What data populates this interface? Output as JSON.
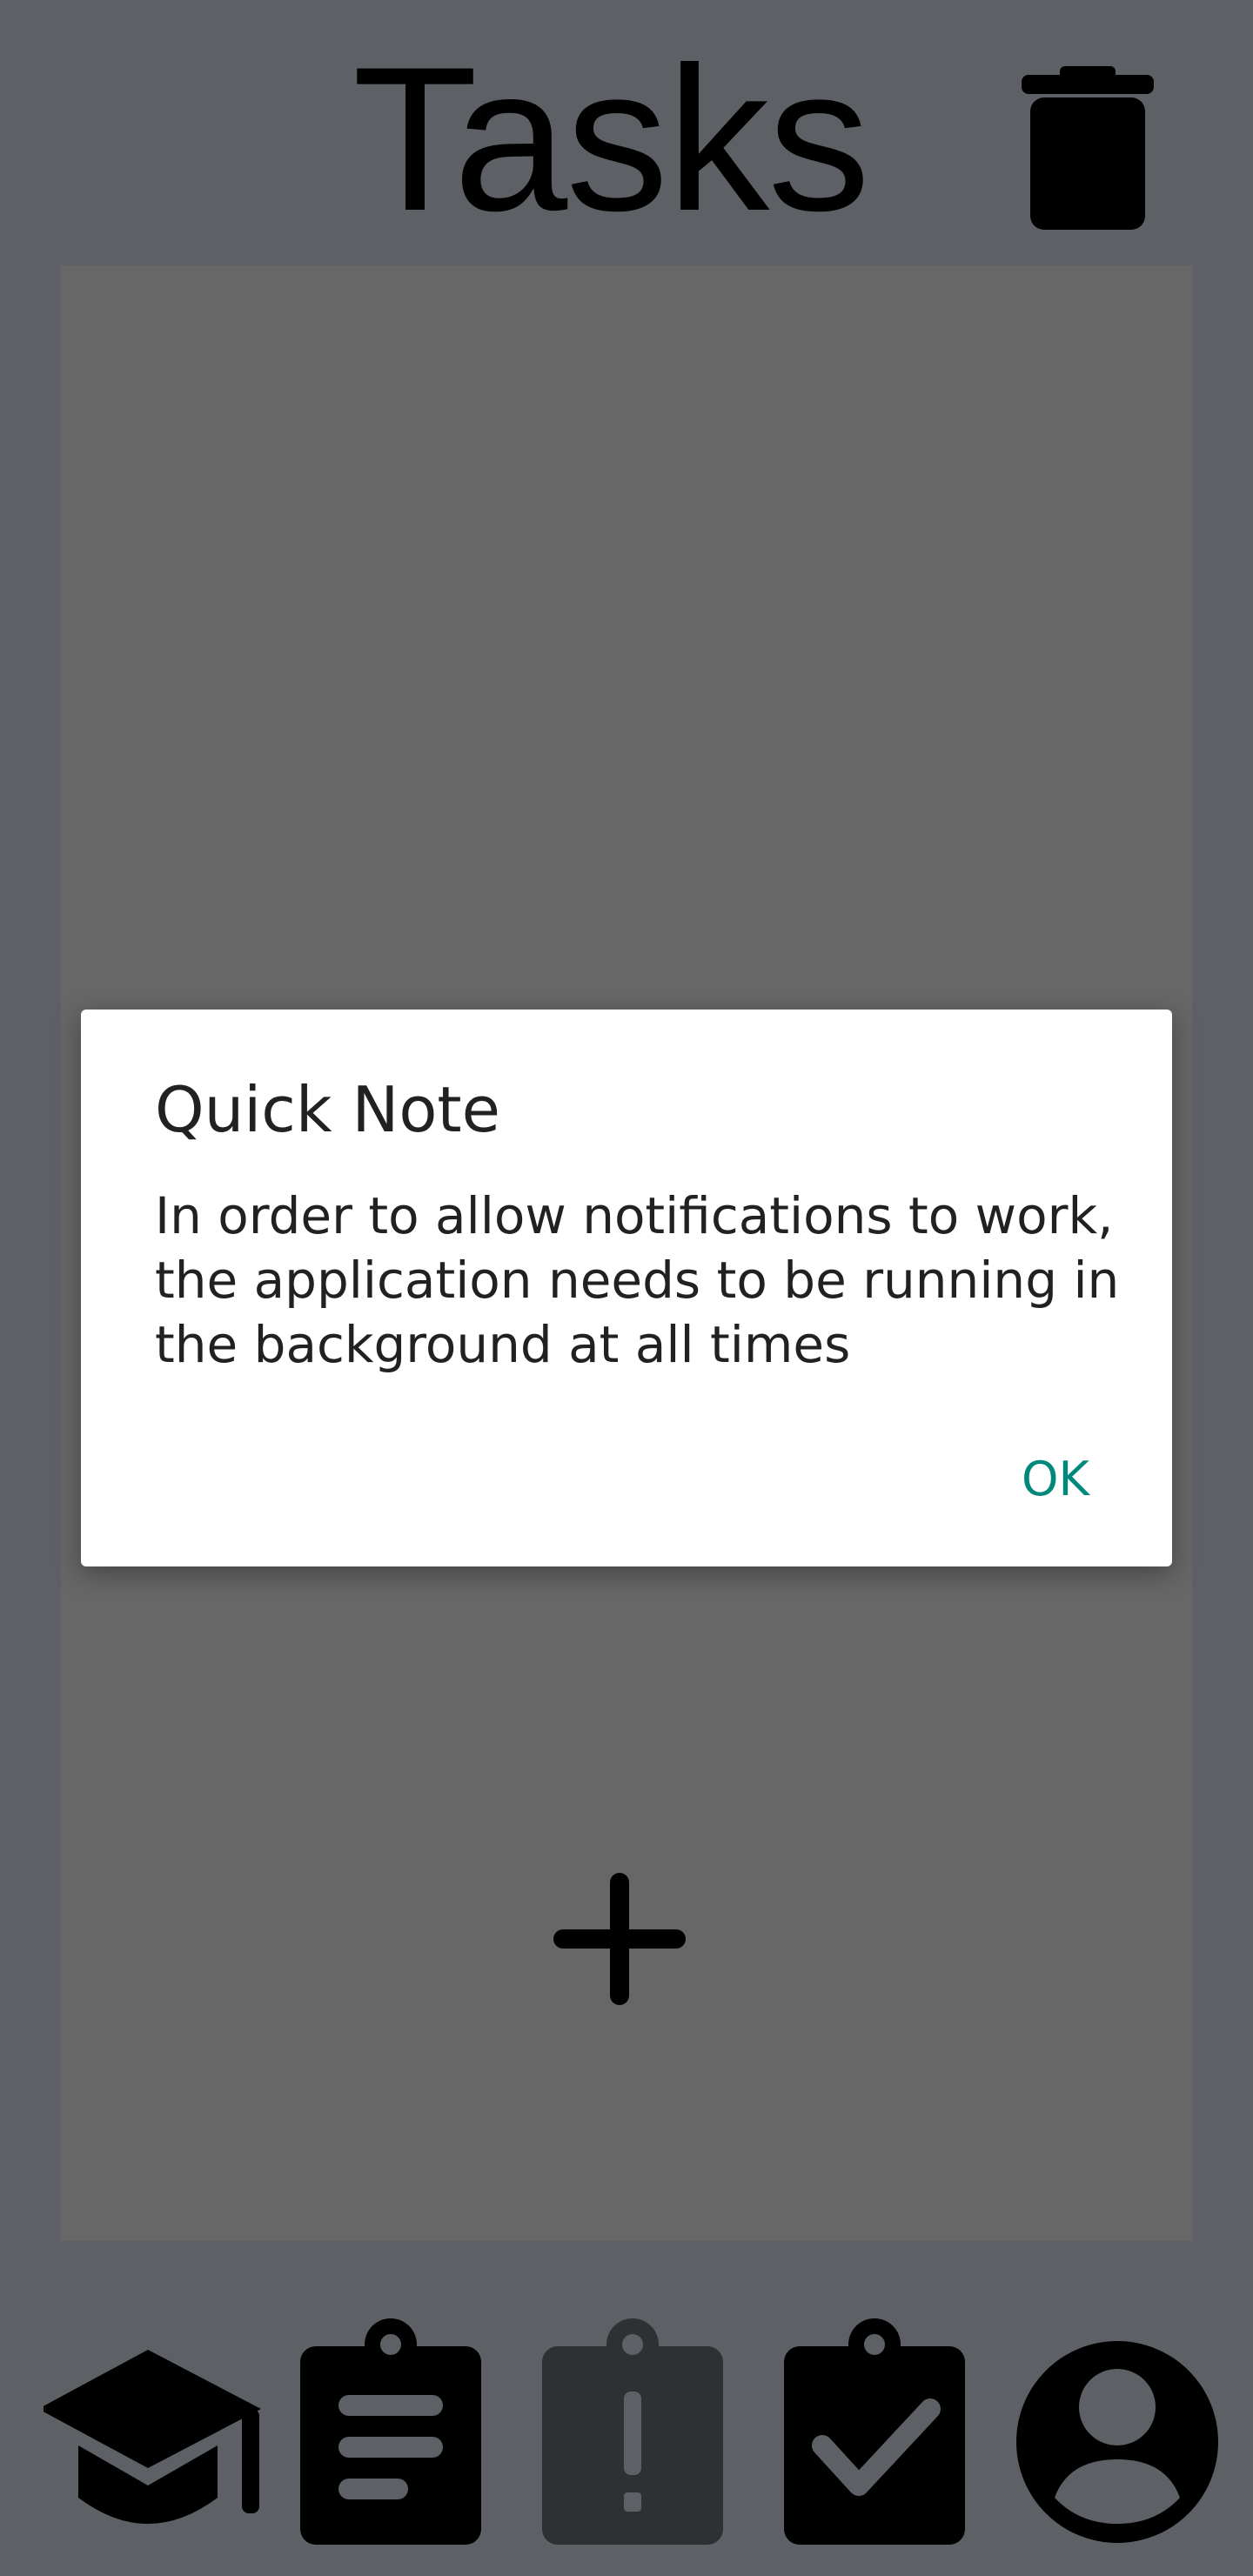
{
  "header": {
    "title": "Tasks",
    "delete_icon": "trash-icon"
  },
  "main": {
    "add_icon": "plus-icon"
  },
  "dialog": {
    "title": "Quick Note",
    "message": "In order to allow notifications to work, the application needs to be running in the background at all times",
    "ok_label": "OK"
  },
  "bottom_nav": {
    "items": [
      {
        "icon": "graduation-cap-icon",
        "active": false
      },
      {
        "icon": "clipboard-list-icon",
        "active": false
      },
      {
        "icon": "clipboard-alert-icon",
        "active": true
      },
      {
        "icon": "clipboard-check-icon",
        "active": false
      },
      {
        "icon": "account-circle-icon",
        "active": false
      }
    ]
  },
  "colors": {
    "background": "#5d6166",
    "panel": "#676767",
    "dialog_bg": "#ffffff",
    "accent": "#00897b",
    "active_icon": "#2f3033",
    "icon": "#000000"
  }
}
